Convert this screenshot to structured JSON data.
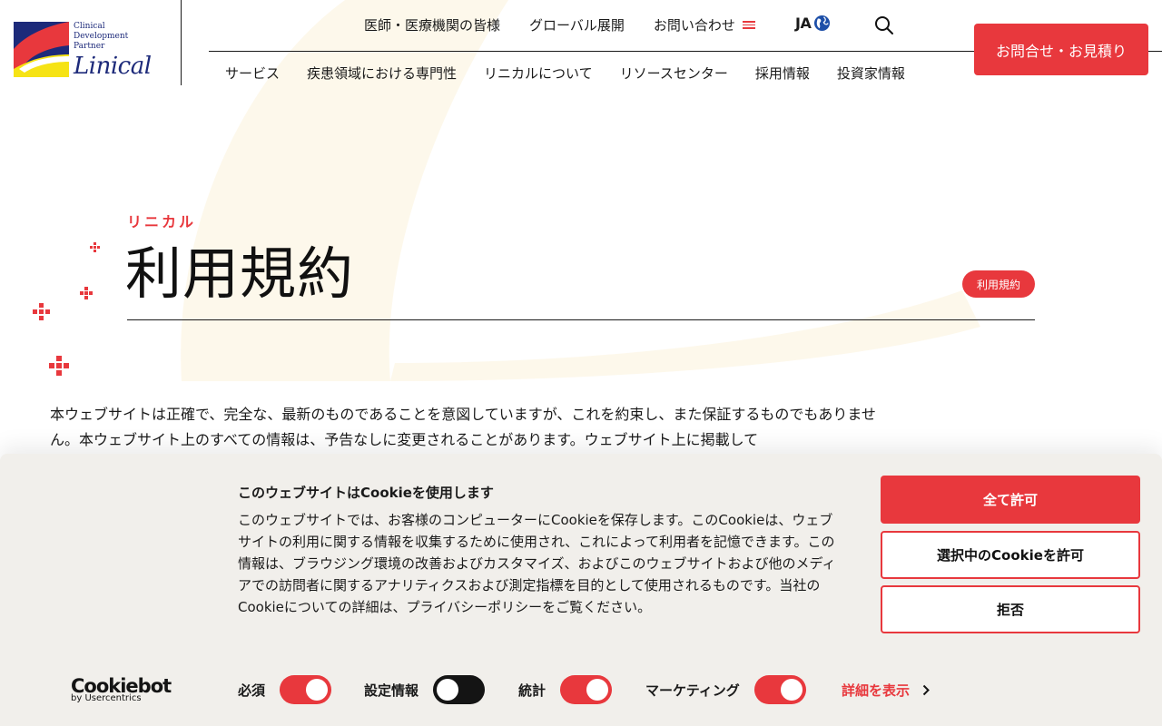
{
  "brand": {
    "tagline": [
      "Clinical",
      "Development",
      "Partner"
    ],
    "name": "Linical",
    "accent": "#e8383d",
    "navy": "#1d2a7a",
    "yellow": "#f6e315"
  },
  "header": {
    "top_nav": [
      "医師・医療機関の皆様",
      "グローバル展開",
      "お問い合わせ"
    ],
    "lang": "JA",
    "main_nav": [
      "サービス",
      "疾患領域における専門性",
      "リニカルについて",
      "リソースセンター",
      "採用情報",
      "投資家情報"
    ],
    "cta": "お問合せ・お見積り"
  },
  "hero": {
    "eyebrow": "リニカル",
    "title": "利用規約",
    "breadcrumb_badge": "利用規約"
  },
  "body": {
    "paragraph": "本ウェブサイトは正確で、完全な、最新のものであることを意図していますが、これを約束し、また保証するものでもありません。本ウェブサイト上のすべての情報は、予告なしに変更されることがあります。ウェブサイト上に掲載して"
  },
  "cookie": {
    "title": "このウェブサイトはCookieを使用します",
    "description": "このウェブサイトでは、お客様のコンピューターにCookieを保存します。このCookieは、ウェブサイトの利用に関する情報を収集するために使用され、これによって利用者を記憶できます。この情報は、ブラウジング環境の改善およびカスタマイズ、およびこのウェブサイトおよび他のメディアでの訪問者に関するアナリティクスおよび測定指標を目的として使用されるものです。当社のCookieについての詳細は、プライバシーポリシーをご覧ください。",
    "allow_all": "全て許可",
    "allow_selection": "選択中のCookieを許可",
    "deny": "拒否",
    "provider": "Cookiebot",
    "provider_by": "by Usercentrics",
    "toggles": [
      {
        "label": "必須",
        "state": "on"
      },
      {
        "label": "設定情報",
        "state": "off"
      },
      {
        "label": "統計",
        "state": "on"
      },
      {
        "label": "マーケティング",
        "state": "on"
      }
    ],
    "details_link": "詳細を表示"
  }
}
